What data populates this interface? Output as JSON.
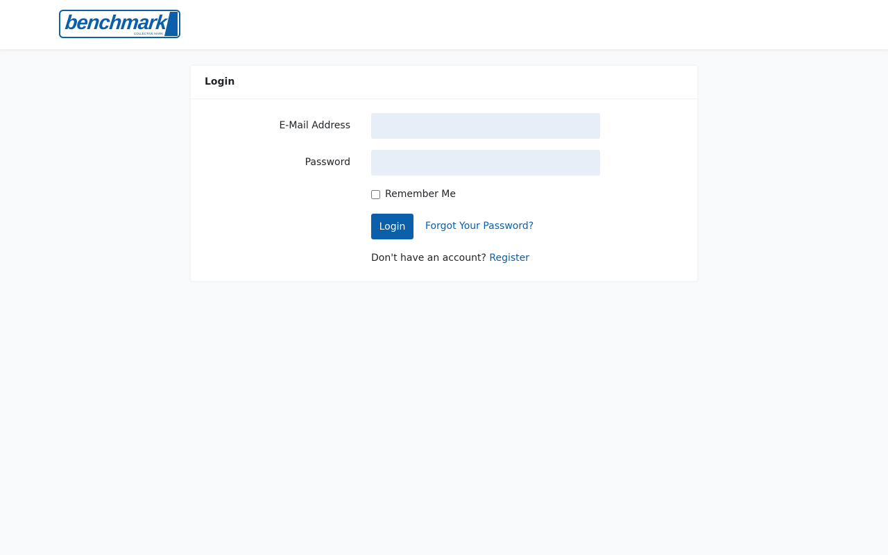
{
  "brand": {
    "logo_text": "benchmark",
    "logo_subtext": "COLLECTIVE MARK",
    "color": "#0a5fa8"
  },
  "login_card": {
    "title": "Login",
    "email": {
      "label": "E-Mail Address",
      "value": "",
      "placeholder": ""
    },
    "password": {
      "label": "Password",
      "value": "",
      "placeholder": ""
    },
    "remember_me": {
      "label": "Remember Me",
      "checked": false
    },
    "submit_label": "Login",
    "forgot_password_label": "Forgot Your Password?",
    "no_account_text": "Don't have an account?",
    "register_label": "Register"
  },
  "colors": {
    "accent": "#0a5fa8",
    "page_background": "#f8f9fb",
    "input_background": "#e7eef7"
  }
}
